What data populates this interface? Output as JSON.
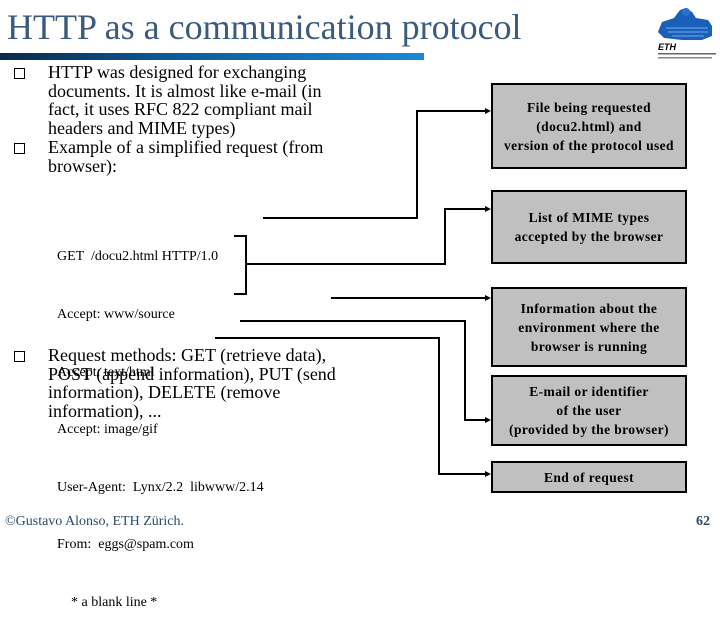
{
  "slide": {
    "title": "HTTP as a communication protocol",
    "logo_label": "ETH",
    "bullets": [
      "HTTP was designed for exchanging documents. It is almost like e-mail (in fact, it uses RFC 822 compliant mail headers and MIME types)",
      "Example of a simplified request (from browser):",
      "Request methods: GET (retrieve data), POST (append information), PUT  (send information), DELETE (remove information), ..."
    ],
    "request_lines": [
      "GET  /docu2.html HTTP/1.0",
      "Accept: www/source",
      "Accept: text/html",
      "Accept: image/gif",
      "User-Agent:  Lynx/2.2  libwww/2.14",
      "From:  eggs@spam.com",
      "    * a blank line *"
    ],
    "annotations": [
      "File being requested\n(docu2.html) and\nversion of the protocol used",
      "List of MIME types\naccepted by the browser",
      "Information about the\nenvironment where the\nbrowser is running",
      "E-mail or identifier\nof the user\n(provided by the browser)",
      "End of request"
    ],
    "footer": {
      "copyright": "©Gustavo Alonso,  ETH Zürich.",
      "page_number": "62"
    }
  }
}
